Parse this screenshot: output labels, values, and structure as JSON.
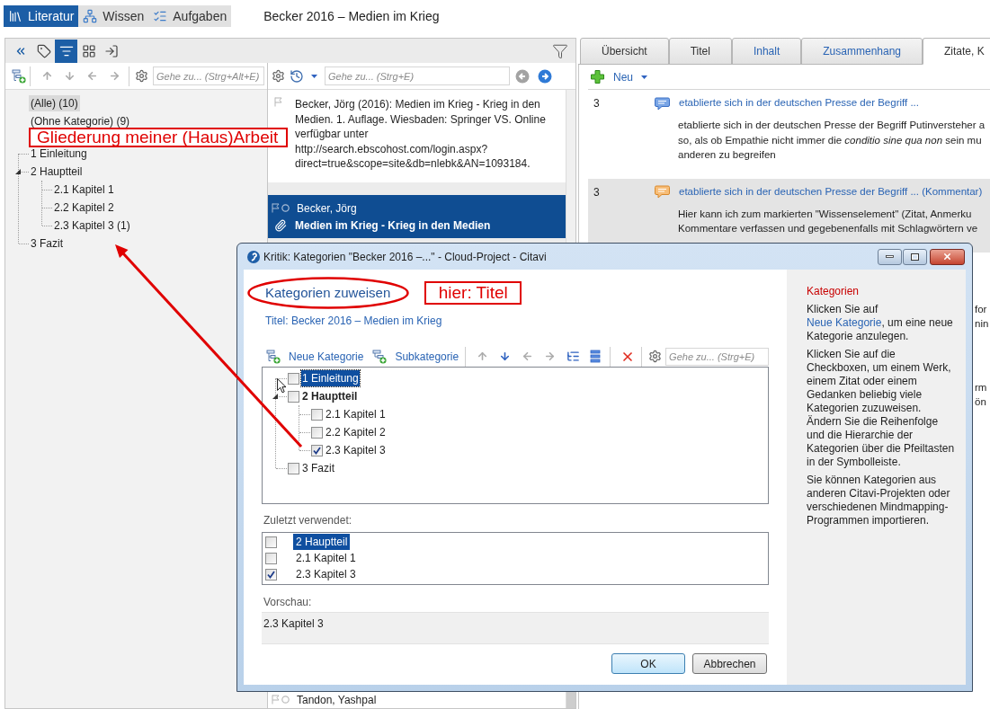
{
  "nav_tabs": [
    {
      "kind": "references",
      "label": "Literatur",
      "selected": true
    },
    {
      "kind": "knowledge",
      "label": "Wissen",
      "selected": false
    },
    {
      "kind": "tasks",
      "label": "Aufgaben",
      "selected": false
    }
  ],
  "document_title": "Becker 2016 – Medien im Krieg",
  "panel_tools": [
    {
      "kind": "keywords",
      "selected": false
    },
    {
      "kind": "categories",
      "selected": true
    },
    {
      "kind": "groups",
      "selected": false
    },
    {
      "kind": "import",
      "selected": false
    }
  ],
  "categories": {
    "move_buttons": [
      {
        "kind": "up",
        "disabled": true
      },
      {
        "kind": "down",
        "disabled": true
      },
      {
        "kind": "left",
        "disabled": true
      },
      {
        "kind": "right",
        "disabled": true
      }
    ],
    "search": {
      "placeholder": "Gehe zu... (Strg+Alt+E)"
    },
    "filters": [
      {
        "label": "(Alle) (10)",
        "selected": true
      },
      {
        "label": "(Ohne Kategorie) (9)",
        "selected": false
      }
    ],
    "annotation": "Gliederung meiner (Haus)Arbeit",
    "tree": [
      {
        "label": "1 Einleitung",
        "selected": false
      },
      {
        "label": "2 Hauptteil",
        "selected": false,
        "expanded": true,
        "children": [
          {
            "label": "2.1 Kapitel 1",
            "selected": false
          },
          {
            "label": "2.2 Kapitel 2",
            "selected": false
          },
          {
            "label": "2.3 Kapitel 3 (1)",
            "selected": false
          }
        ]
      },
      {
        "label": "3 Fazit",
        "selected": false
      }
    ]
  },
  "references": {
    "search": {
      "placeholder": "Gehe zu... (Strg+E)"
    },
    "nav_buttons": [
      {
        "kind": "back",
        "disabled": true
      },
      {
        "kind": "forward",
        "disabled": false
      }
    ],
    "citation": "Becker, Jörg (2016): Medien im Krieg - Krieg in den Medien. 1. Auflage. Wiesbaden: Springer VS. Online verfügbar unter http://search.ebscohost.com/login.aspx?direct=true&scope=site&db=nlebk&AN=1093184.",
    "items": [
      {
        "author": "Becker, Jörg",
        "title": "Medien im Krieg - Krieg in den Medien",
        "selected": true,
        "attachment": true
      },
      {
        "author": "Tandon, Yashpal",
        "selected": false
      }
    ]
  },
  "details": {
    "tabs": [
      {
        "label": "Übersicht",
        "selected": false,
        "highlighted": false
      },
      {
        "label": "Titel",
        "selected": false,
        "highlighted": false
      },
      {
        "label": "Inhalt",
        "selected": false,
        "highlighted": true
      },
      {
        "label": "Zusammenhang",
        "selected": false,
        "highlighted": true
      },
      {
        "label": "Zitate, K",
        "selected": true,
        "highlighted": false
      }
    ],
    "new_button": "Neu",
    "entries": [
      {
        "kind": "quote",
        "page": "3",
        "heading": "etablierte sich in der deutschen Presse der Begriff ...",
        "lines": [
          "etablierte sich in der deutschen Presse der Begriff Putinversteher a",
          "so, als ob Empathie nicht immer die *conditio sine qua non* sein mu",
          "anderen zu begreifen"
        ],
        "selected": false
      },
      {
        "kind": "comment",
        "page": "3",
        "heading": "etablierte sich in der deutschen Presse der Begriff ... (Kommentar)",
        "lines": [
          "Hier kann ich zum markierten \"Wissenselement\" (Zitat, Anmerku",
          "Kommentare verfassen und gegebenenfalls mit Schlagwörtern ve"
        ],
        "selected": true
      }
    ],
    "cut_off_entries": [
      {
        "lines": [
          "for",
          "nin"
        ]
      },
      {
        "lines": [
          "rm",
          "ön"
        ]
      }
    ]
  },
  "dialog": {
    "title": "Kritik: Kategorien \"Becker 2016 –...\" - Cloud-Project - Citavi",
    "heading": "Kategorien zuweisen",
    "note": "hier: Titel",
    "subtitle": "Titel: Becker 2016 – Medien im Krieg",
    "actions": [
      {
        "kind": "new",
        "label": "Neue Kategorie"
      },
      {
        "kind": "sub",
        "label": "Subkategorie"
      }
    ],
    "move_buttons": [
      {
        "kind": "up",
        "disabled": true
      },
      {
        "kind": "down",
        "disabled": false
      },
      {
        "kind": "left",
        "disabled": true
      },
      {
        "kind": "right",
        "disabled": true
      }
    ],
    "search": {
      "placeholder": "Gehe zu... (Strg+E)"
    },
    "tree": [
      {
        "label": "1 Einleitung",
        "checked": false,
        "selected": true
      },
      {
        "label": "2 Hauptteil",
        "checked": false,
        "selected": false,
        "expanded": true,
        "contains_checked": true,
        "children": [
          {
            "label": "2.1 Kapitel 1",
            "checked": false,
            "selected": false
          },
          {
            "label": "2.2 Kapitel 2",
            "checked": false,
            "selected": false
          },
          {
            "label": "2.3 Kapitel 3",
            "checked": true,
            "selected": false
          }
        ]
      },
      {
        "label": "3 Fazit",
        "checked": false,
        "selected": false
      }
    ],
    "recent_label": "Zuletzt verwendet:",
    "recent": [
      {
        "label": "2 Hauptteil",
        "checked": false,
        "selected": true
      },
      {
        "label": "2.1 Kapitel 1",
        "checked": false,
        "selected": false
      },
      {
        "label": "2.3 Kapitel 3",
        "checked": true,
        "selected": false
      }
    ],
    "preview_label": "Vorschau:",
    "preview": "2.3 Kapitel 3",
    "buttons": [
      {
        "label": "OK",
        "default": true
      },
      {
        "label": "Abbrechen",
        "default": false
      }
    ],
    "help": {
      "heading": "Kategorien",
      "paragraphs": [
        {
          "text": "Klicken Sie auf ",
          "link": "Neue Kategorie",
          "after": ", um eine neue Kategorie anzulegen."
        },
        {
          "text": "Klicken Sie auf die Checkboxen, um einem Werk, einem Zitat oder einem Gedanken beliebig viele Kategorien zuzuweisen. Ändern Sie die Reihenfolge und die Hierarchie der Kategorien über die Pfeiltasten in der Symbolleiste."
        },
        {
          "text": "Sie können Kategorien aus anderen Citavi-Projekten oder verschiedenen Mindmapping-Programmen importieren."
        }
      ]
    }
  }
}
